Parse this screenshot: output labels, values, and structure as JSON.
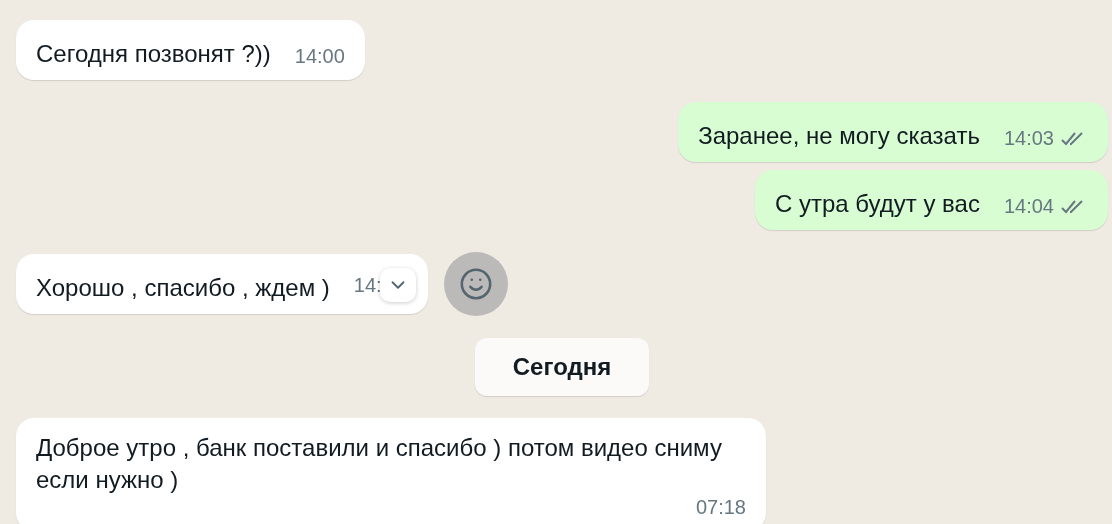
{
  "messages": [
    {
      "kind": "incoming",
      "text": "Сегодня позвонят ?))",
      "time": "14:00",
      "hovered": false
    },
    {
      "kind": "outgoing",
      "text": "Заранее, не могу сказать",
      "time": "14:03",
      "read": false,
      "hovered": false
    },
    {
      "kind": "outgoing",
      "text": "С утра будут у вас",
      "time": "14:04",
      "read": false,
      "hovered": false
    },
    {
      "kind": "incoming",
      "text": "Хорошо , спасибо , ждем )",
      "time": "14:",
      "hovered": true
    },
    {
      "kind": "date",
      "text": "Сегодня"
    },
    {
      "kind": "incoming",
      "text": "Доброе утро , банк поставили и спасибо ) потом видео сниму если нужно )",
      "time": "07:18",
      "hovered": false
    }
  ]
}
